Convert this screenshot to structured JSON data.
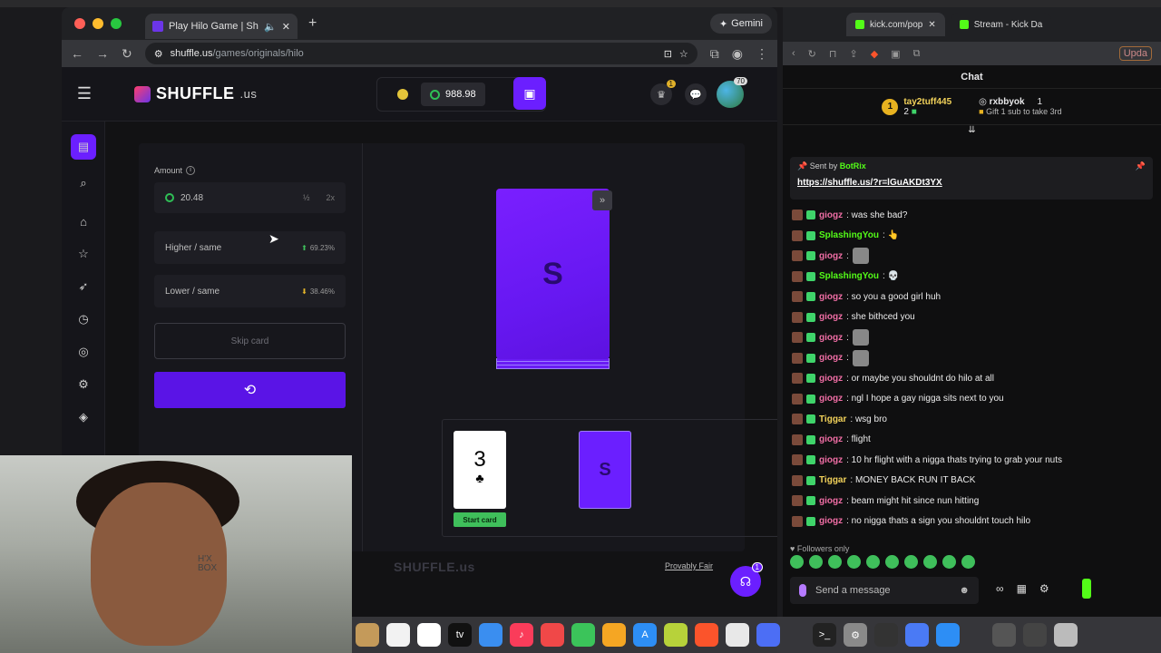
{
  "browser_left": {
    "tab_title": "Play Hilo Game | Shuffle.us",
    "gemini_label": "Gemini",
    "url_domain": "shuffle.us",
    "url_path": "/games/originals/hilo"
  },
  "site": {
    "logo_text": "SHUFFLE",
    "logo_suffix": ".us",
    "balance": "988.98",
    "notif_count": "1",
    "level_badge": "70"
  },
  "hilo": {
    "amount_label": "Amount",
    "amount_value": "20.48",
    "half_label": "½",
    "double_label": "2x",
    "higher_label": "Higher / same",
    "higher_pct": "69.23%",
    "lower_label": "Lower / same",
    "lower_pct": "38.46%",
    "skip_label": "Skip card",
    "start_card_rank": "3",
    "start_card_suit": "♣",
    "start_card_tag": "Start card",
    "footer_logo": "SHUFFLE.us",
    "provably_fair": "Provably Fair",
    "support_badge": "1"
  },
  "webcam": {
    "sign_text": "H'X\nBOX"
  },
  "browser_right": {
    "tab1": "kick.com/pop",
    "tab2": "Stream - Kick Da",
    "update_label": "Upda",
    "chat_title": "Chat",
    "gifter1_name": "tay2tuff445",
    "gifter1_count": "2",
    "gifter2_name": "rxbbyok",
    "gifter2_count": "1",
    "gifter2_sub": "Gift 1 sub to take 3rd",
    "pinned_sent_by": "Sent by",
    "pinned_bot": "BotRix",
    "pinned_link": "https://shuffle.us/?r=lGuAKDt3YX",
    "followers_only": "Followers only",
    "send_placeholder": "Send a message"
  },
  "chat_messages": [
    {
      "user": "giogz",
      "color": "#f06ea5",
      "text": "was she bad?"
    },
    {
      "user": "SplashingYou",
      "color": "#53fc18",
      "text": "👆"
    },
    {
      "user": "giogz",
      "color": "#f06ea5",
      "text": ""
    },
    {
      "user": "SplashingYou",
      "color": "#53fc18",
      "text": "💀"
    },
    {
      "user": "giogz",
      "color": "#f06ea5",
      "text": "so you a good girl huh"
    },
    {
      "user": "giogz",
      "color": "#f06ea5",
      "text": "she bithced you"
    },
    {
      "user": "giogz",
      "color": "#f06ea5",
      "text": ""
    },
    {
      "user": "giogz",
      "color": "#f06ea5",
      "text": ""
    },
    {
      "user": "giogz",
      "color": "#f06ea5",
      "text": "or maybe you shouldnt do hilo at all"
    },
    {
      "user": "giogz",
      "color": "#f06ea5",
      "text": "ngl I hope a gay nigga sits next to you"
    },
    {
      "user": "Tiggar",
      "color": "#f2d25a",
      "text": "wsg bro"
    },
    {
      "user": "giogz",
      "color": "#f06ea5",
      "text": "flight"
    },
    {
      "user": "giogz",
      "color": "#f06ea5",
      "text": "10 hr flight with a nigga thats trying to grab your nuts"
    },
    {
      "user": "Tiggar",
      "color": "#f2d25a",
      "text": "MONEY BACK RUN IT BACK"
    },
    {
      "user": "giogz",
      "color": "#f06ea5",
      "text": "beam might hit since nun hitting"
    },
    {
      "user": "giogz",
      "color": "#f06ea5",
      "text": "no nigga thats a sign you shouldnt touch hilo"
    }
  ]
}
